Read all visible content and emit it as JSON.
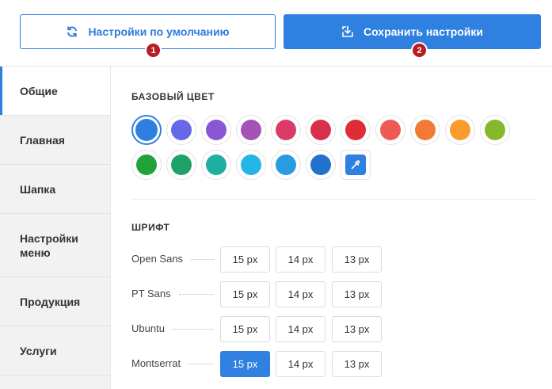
{
  "toolbar": {
    "reset_label": "Настройки по умолчанию",
    "save_label": "Сохранить настройки",
    "reset_badge": "1",
    "save_badge": "2",
    "accent": "#2f80e0",
    "badge_color": "#b71d25"
  },
  "sidebar": {
    "items": [
      {
        "label": "Общие",
        "active": true
      },
      {
        "label": "Главная",
        "active": false
      },
      {
        "label": "Шапка",
        "active": false
      },
      {
        "label": "Настройки\nменю",
        "active": false
      },
      {
        "label": "Продукция",
        "active": false
      },
      {
        "label": "Услуги",
        "active": false
      }
    ]
  },
  "base_color": {
    "title": "БАЗОВЫЙ ЦВЕТ",
    "selected": "#2f7fe0",
    "row1": [
      "#2f7fe0",
      "#6767ea",
      "#8a56d6",
      "#a552b7",
      "#dc3b6a",
      "#d8304b",
      "#e02c36",
      "#ee5b57",
      "#f07a36",
      "#f99c2c",
      "#86b82b"
    ],
    "row2": [
      "#22a23a",
      "#1ea26a",
      "#1eafa2",
      "#23b5e5",
      "#2a9be0",
      "#2172cc"
    ],
    "picker_icon": "eyedropper-icon"
  },
  "font": {
    "title": "ШРИФТ",
    "rows": [
      {
        "name": "Open Sans",
        "sizes": [
          "15 px",
          "14 px",
          "13 px"
        ],
        "active": -1
      },
      {
        "name": "PT Sans",
        "sizes": [
          "15 px",
          "14 px",
          "13 px"
        ],
        "active": -1
      },
      {
        "name": "Ubuntu",
        "sizes": [
          "15 px",
          "14 px",
          "13 px"
        ],
        "active": -1
      },
      {
        "name": "Montserrat",
        "sizes": [
          "15 px",
          "14 px",
          "13 px"
        ],
        "active": 0
      }
    ]
  }
}
